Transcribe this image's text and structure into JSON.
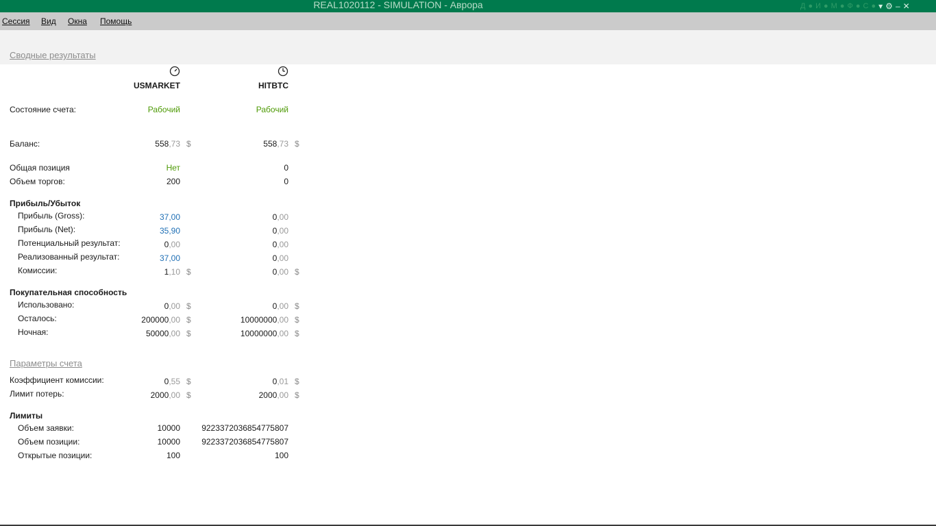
{
  "window": {
    "title": "REAL1020112 - SIMULATION - Аврора",
    "title_icons": [
      "Д",
      "И",
      "М",
      "Ф",
      "С"
    ]
  },
  "menu": {
    "session": "Сессия",
    "view": "Вид",
    "windows": "Окна",
    "help": "Помощь"
  },
  "summary_link": "Сводные результаты",
  "params_link": "Параметры счета",
  "columns": {
    "left": {
      "name": "USMARKET"
    },
    "right": {
      "name": "HITBTC"
    }
  },
  "currency": "$",
  "labels": {
    "account_state": "Состояние счета:",
    "balance": "Баланс:",
    "total_position": "Общая позиция",
    "trade_volume": "Объем торгов:",
    "pnl_group": "Прибыль/Убыток",
    "gross": "Прибыль (Gross):",
    "net": "Прибыль (Net):",
    "potential": "Потенциальный результат:",
    "realized": "Реализованный результат:",
    "commission": "Комиссии:",
    "bp_group": "Покупательная способность",
    "used": "Использовано:",
    "left": "Осталось:",
    "night": "Ночная:",
    "commission_coef": "Коэффициент комиссии:",
    "loss_limit": "Лимит потерь:",
    "limits_group": "Лимиты",
    "order_volume": "Объем заявки:",
    "position_volume": "Объем позиции:",
    "open_positions": "Открытые позиции:"
  },
  "usmarket": {
    "state": "Рабочий",
    "balance_i": "558",
    "balance_d": ",73",
    "position": "Нет",
    "volume": "200",
    "gross_i": "37",
    "gross_d": ",00",
    "net_i": "35",
    "net_d": ",90",
    "potential_i": "0",
    "potential_d": ",00",
    "realized_i": "37",
    "realized_d": ",00",
    "commission_i": "1",
    "commission_d": ",10",
    "used_i": "0",
    "used_d": ",00",
    "left_i": "200000",
    "left_d": ",00",
    "night_i": "50000",
    "night_d": ",00",
    "coef_i": "0",
    "coef_d": ",55",
    "losslimit_i": "2000",
    "losslimit_d": ",00",
    "order_vol": "10000",
    "pos_vol": "10000",
    "open_pos": "100"
  },
  "hitbtc": {
    "state": "Рабочий",
    "balance_i": "558",
    "balance_d": ",73",
    "position": "0",
    "volume": "0",
    "gross_i": "0",
    "gross_d": ",00",
    "net_i": "0",
    "net_d": ",00",
    "potential_i": "0",
    "potential_d": ",00",
    "realized_i": "0",
    "realized_d": ",00",
    "commission_i": "0",
    "commission_d": ",00",
    "used_i": "0",
    "used_d": ",00",
    "left_i": "10000000",
    "left_d": ",00",
    "night_i": "10000000",
    "night_d": ",00",
    "coef_i": "0",
    "coef_d": ",01",
    "losslimit_i": "2000",
    "losslimit_d": ",00",
    "order_vol": "9223372036854775807",
    "pos_vol": "9223372036854775807",
    "open_pos": "100"
  },
  "colors": {
    "titlebar": "#007a4d",
    "menubar": "#cbcbcb",
    "state_green": "#4e9a06",
    "profit_blue": "#1f6fb5"
  }
}
